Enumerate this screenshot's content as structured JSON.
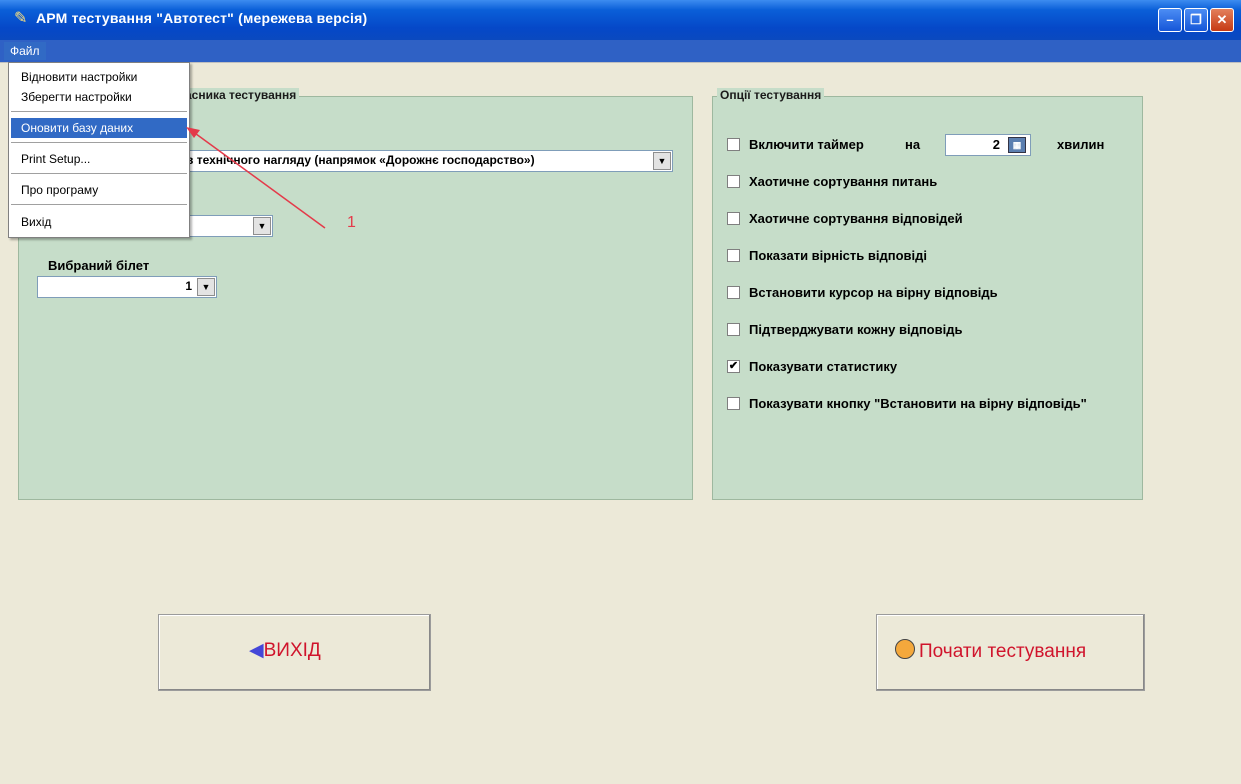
{
  "window": {
    "title": "АРМ тестування \"Автотест\" (мережева версія)",
    "minimize": "–",
    "maximize": "❐",
    "close": "✕"
  },
  "menubar": {
    "file": "Файл"
  },
  "file_menu": {
    "items": [
      "Відновити настройки",
      "Зберегти настройки",
      "Оновити базу даних",
      "Print Setup...",
      "Про програму",
      "Вихід"
    ],
    "selected": "Оновити базу даних"
  },
  "left_group": {
    "title_visible": "асника тестування",
    "category_combo": "в технічного нагляду (напрямок «Дорожнє господарство»)",
    "ticket_label": "Вибраний білет",
    "ticket_value": "1"
  },
  "options_group": {
    "title": "Опції тестування",
    "timer": {
      "label": "Включити таймер",
      "on": "на",
      "value": "2",
      "unit": "хвилин",
      "checked": false
    },
    "items": [
      {
        "label": "Хаотичне сортування питань",
        "checked": false
      },
      {
        "label": "Хаотичне сортування відповідей",
        "checked": false
      },
      {
        "label": "Показати вірність відповіді",
        "checked": false
      },
      {
        "label": "Встановити курсор на вірну відповідь",
        "checked": false
      },
      {
        "label": "Підтверджувати кожну відповідь",
        "checked": false
      },
      {
        "label": "Показувати статистику",
        "checked": true
      },
      {
        "label": "Показувати кнопку \"Встановити на вірну відповідь\"",
        "checked": false
      }
    ]
  },
  "buttons": {
    "exit": "ВИХІД",
    "start": "Почати тестування"
  },
  "annotation": {
    "number": "1",
    "color": "#e43a4a"
  },
  "icons": {
    "title": "pencil-icon",
    "exit": "back-arrow-icon",
    "start": "person-icon",
    "calc": "calculator-icon"
  },
  "colors": {
    "group_bg": "#c6ddc9",
    "title_bar": "#0548c8",
    "button_text": "#d0142c"
  }
}
